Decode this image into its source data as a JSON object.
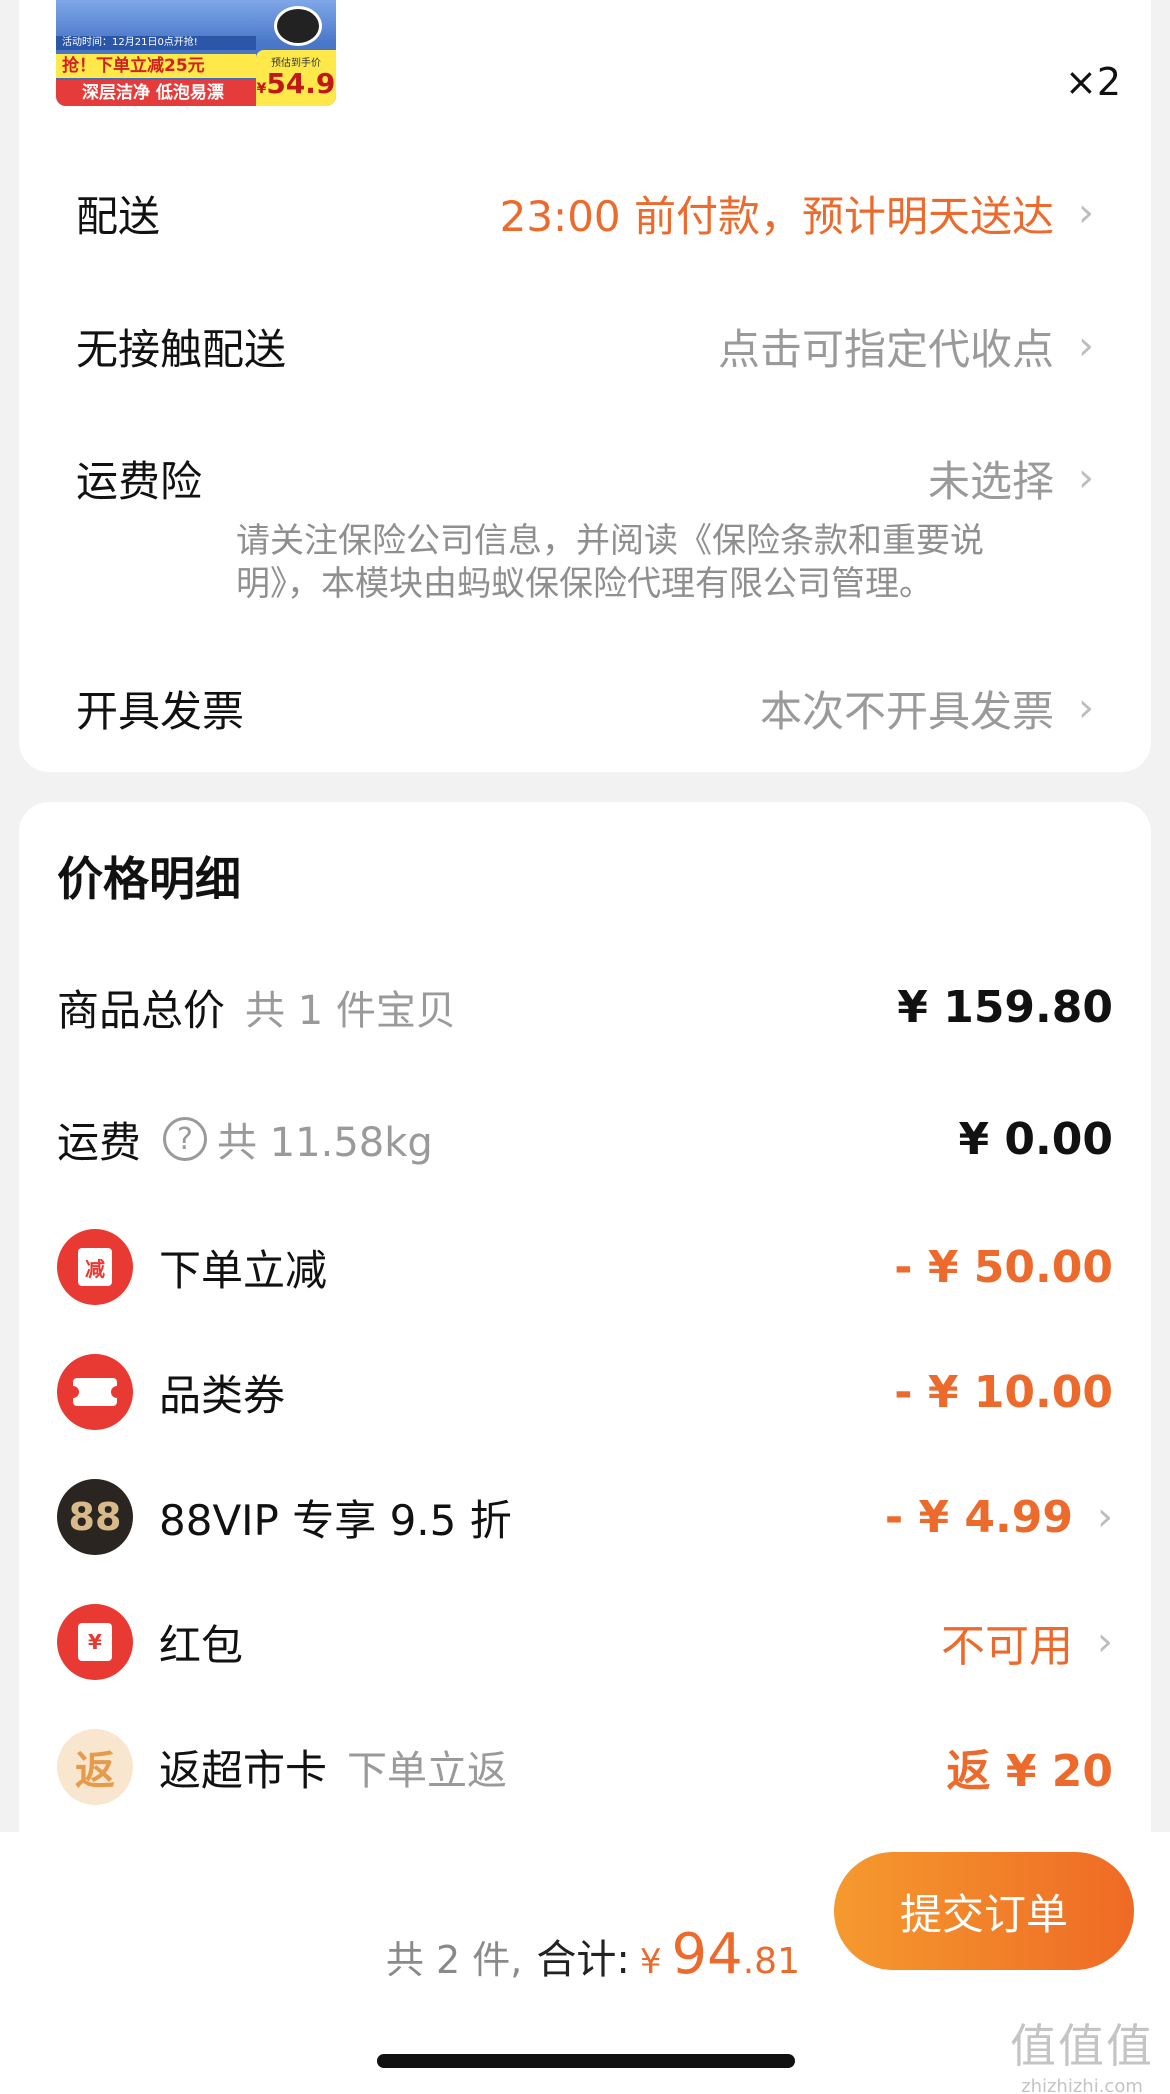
{
  "product": {
    "image": {
      "activity_text": "活动时间：12月21日0点开抢!",
      "promo_text": "抢！下单立减25元",
      "tagline": "深层洁净 低泡易漂",
      "price_caption": "预估到手价",
      "price_currency": "¥",
      "price_value": "54.9"
    },
    "quantity": "×2"
  },
  "order_options": {
    "delivery": {
      "label": "配送",
      "value": "23:00 前付款，预计明天送达"
    },
    "contactless": {
      "label": "无接触配送",
      "value": "点击可指定代收点"
    },
    "shipping_insurance": {
      "label": "运费险",
      "value": "未选择",
      "note": "请关注保险公司信息，并阅读《保险条款和重要说明》，本模块由蚂蚁保保险代理有限公司管理。"
    },
    "invoice": {
      "label": "开具发票",
      "value": "本次不开具发票"
    }
  },
  "price_details": {
    "title": "价格明细",
    "goods_total": {
      "label": "商品总价",
      "sub": "共 1 件宝贝",
      "amount": "¥ 159.80"
    },
    "shipping": {
      "label": "运费",
      "sub": "共 11.58kg",
      "amount": "¥ 0.00",
      "help_icon": "?"
    },
    "instant_discount": {
      "icon_text": "减",
      "label": "下单立减",
      "amount": "- ¥ 50.00"
    },
    "category_coupon": {
      "label": "品类券",
      "amount": "- ¥ 10.00"
    },
    "vip_discount": {
      "icon_text": "88",
      "label": "88VIP 专享 9.5 折",
      "amount": "- ¥ 4.99"
    },
    "red_packet": {
      "icon_text": "¥",
      "label": "红包",
      "amount": "不可用"
    },
    "supermarket_card": {
      "icon_text": "返",
      "label": "返超市卡",
      "sub": "下单立返",
      "amount": "返 ¥ 20"
    }
  },
  "footer": {
    "count": "共 2 件,",
    "total_label": "合计:",
    "currency": "¥",
    "total_int": "94",
    "total_dec": ".81",
    "submit_label": "提交订单"
  },
  "watermark": {
    "line1": "值值值",
    "line2": "zhizhizhi.com"
  },
  "colors": {
    "accent": "#ec6a2c",
    "icon_red": "#e83a33",
    "vip_dark": "#2b2522"
  }
}
